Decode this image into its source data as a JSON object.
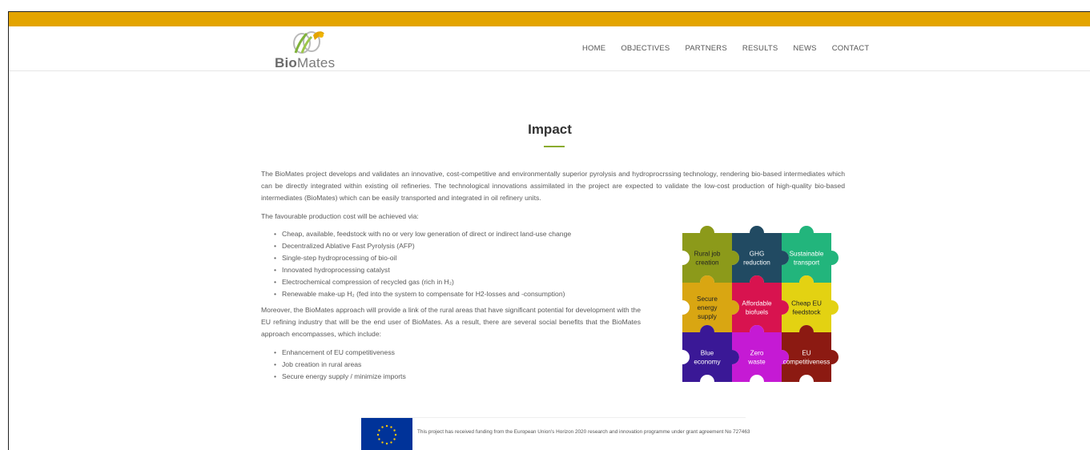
{
  "brand": {
    "prefix": "Bio",
    "suffix": "Mates"
  },
  "nav": {
    "items": [
      "HOME",
      "OBJECTIVES",
      "PARTNERS",
      "RESULTS",
      "NEWS",
      "CONTACT"
    ]
  },
  "main": {
    "title": "Impact",
    "intro": "The BioMates project develops and validates an innovative, cost-competitive and environmentally superior pyrolysis and hydroprocrssing technology, rendering bio-based intermediates which can be directly integrated within existing oil refineries. The technological innovations assimilated in the project are expected to validate the low-cost production of high-quality bio-based intermediates (BioMates) which can be easily transported and integrated in oil refinery units.",
    "production_intro": "The favourable production cost will be achieved via:",
    "production_items": [
      "Cheap, available, feedstock with no or very low generation of direct or indirect land-use change",
      "Decentralized Ablative Fast Pyrolysis (AFP)",
      "Single-step hydroprocessing of bio-oil",
      "Innovated hydroprocessing catalyst",
      "Electrochemical compression of recycled gas (rich in H₂)",
      "Renewable make-up H₂ (fed into the system to compensate for H2-losses and -consumption)"
    ],
    "social_intro": "Moreover, the BioMates approach will provide a link of the rural areas that have significant potential for development with the EU refining industry that will be the end user of BioMates. As a result, there are several social benefits that the BioMates approach encompasses, which include:",
    "social_items": [
      "Enhancement of EU competitiveness",
      "Job creation in rural areas",
      "Secure energy supply / minimize imports"
    ]
  },
  "puzzle": {
    "pieces": [
      {
        "lines": [
          "Rural job",
          "creation"
        ],
        "color": "#8c9a1a"
      },
      {
        "lines": [
          "GHG",
          "reduction"
        ],
        "color": "#214a62"
      },
      {
        "lines": [
          "Sustainable",
          "transport"
        ],
        "color": "#22b57c"
      },
      {
        "lines": [
          "Secure",
          "energy",
          "supply"
        ],
        "color": "#d9a612"
      },
      {
        "lines": [
          "Affordable",
          "biofuels"
        ],
        "color": "#d8134f"
      },
      {
        "lines": [
          "Cheap EU",
          "feedstock"
        ],
        "color": "#e3d212"
      },
      {
        "lines": [
          "Blue",
          "economy"
        ],
        "color": "#3a1896"
      },
      {
        "lines": [
          "Zero",
          "waste"
        ],
        "color": "#c51ad4"
      },
      {
        "lines": [
          "EU",
          "competitiveness"
        ],
        "color": "#8c1a12"
      }
    ]
  },
  "footer": {
    "funding_text": "This project has received funding from the European Union's Horizon 2020 research and innovation programme under grant agreement No 727463"
  },
  "colors": {
    "accent_bar": "#e3a400",
    "title_underline": "#8aab2e",
    "eu_blue": "#003399",
    "eu_star": "#ffcc00"
  }
}
